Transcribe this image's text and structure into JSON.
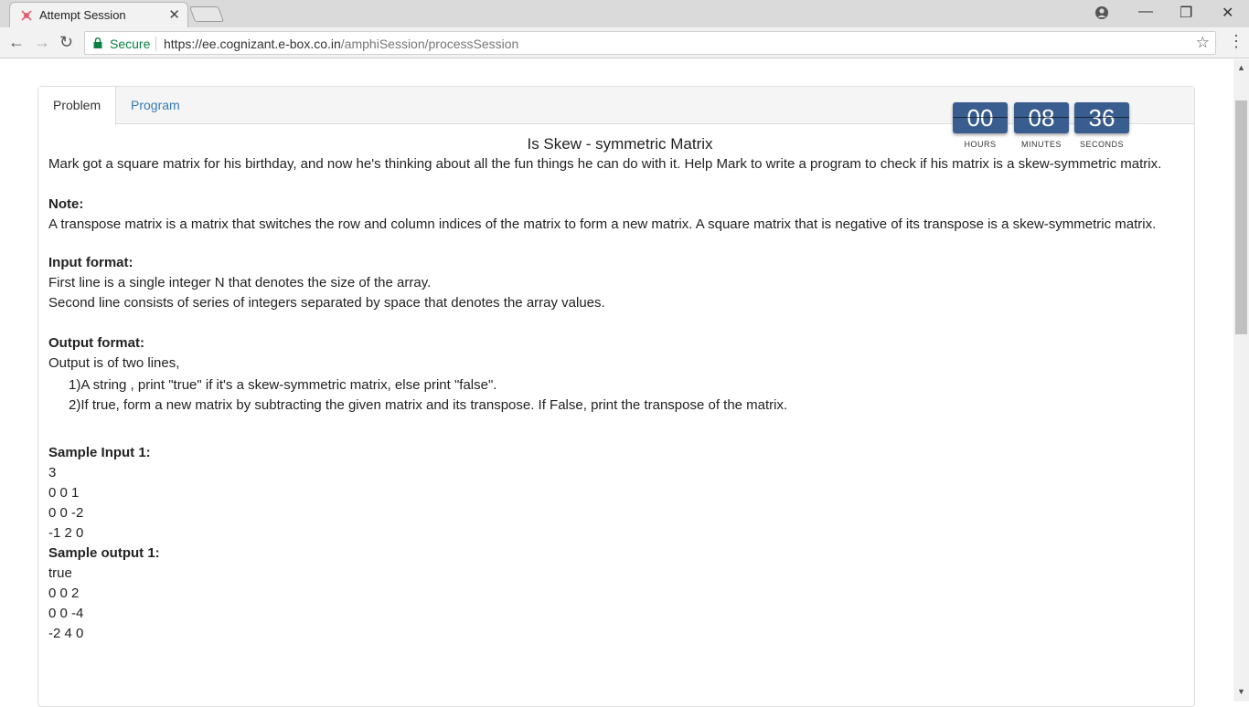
{
  "browser": {
    "tab_title": "Attempt Session",
    "secure_label": "Secure",
    "url_host": "https://ee.cognizant.e-box.co.in",
    "url_path": "/amphiSession/processSession"
  },
  "tabs": [
    "Problem",
    "Program"
  ],
  "timer": {
    "hours": "00",
    "minutes": "08",
    "seconds": "36",
    "hours_label": "HOURS",
    "minutes_label": "MINUTES",
    "seconds_label": "SECONDS"
  },
  "problem": {
    "title": "Is Skew - symmetric Matrix",
    "description": "Mark got a square matrix for his birthday, and now he's thinking about all the fun things he can do with it. Help Mark to write a program to check if his matrix is a skew-symmetric matrix.",
    "note_heading": "Note:",
    "note_text": "A transpose matrix is a matrix that switches the row and column indices of the matrix to form a new matrix. A square matrix that is negative of its transpose is a skew-symmetric matrix.",
    "input_heading": "Input format:",
    "input_line1": "First line is a single integer N that denotes the size of the array.",
    "input_line2": "Second line consists of series of integers separated by space that denotes the array values.",
    "output_heading": "Output format:",
    "output_line1": "Output is of two lines,",
    "output_point1": "1)A string , print \"true\" if it's a skew-symmetric matrix, else print \"false\".",
    "output_point2": "2)If true, form a new matrix by subtracting the given matrix and its transpose. If False, print the transpose of the matrix.",
    "sample_input_heading": "Sample Input 1:",
    "sample_input_lines": [
      "3",
      "0 0 1",
      "0 0 -2",
      "-1 2 0"
    ],
    "sample_output_heading": "Sample output 1:",
    "sample_output_lines": [
      "true",
      "0 0 2",
      "0 0 -4",
      "-2 4 0"
    ]
  }
}
